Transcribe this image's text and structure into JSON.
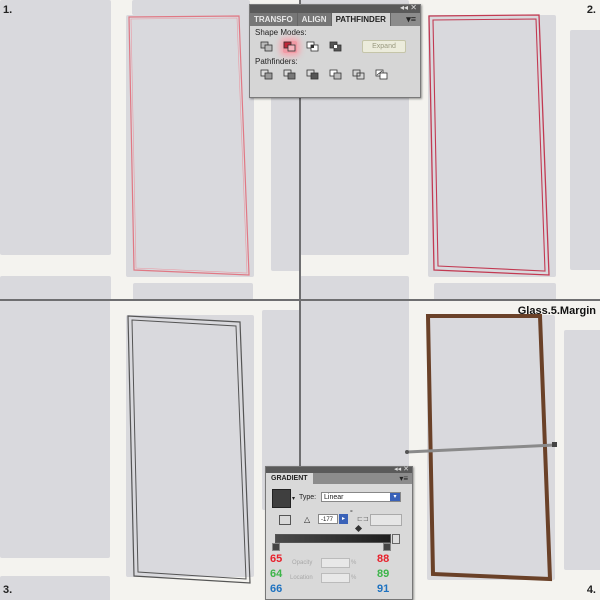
{
  "steps": [
    "1.",
    "2.",
    "3.",
    "4."
  ],
  "caption": "Glass.5.Margin",
  "pathfinder_panel": {
    "tabs": [
      "TRANSFO",
      "ALIGN",
      "PATHFINDER"
    ],
    "active_tab": "PATHFINDER",
    "controls_label": "◂◂ ✕",
    "menu_icon": "▾≡",
    "shape_modes_label": "Shape Modes:",
    "pathfinders_label": "Pathfinders:",
    "expand_label": "Expand",
    "highlighted_mode": "minus-front"
  },
  "gradient_panel": {
    "title": "GRADIENT",
    "menu_icon": "▾≡",
    "controls_label": "◂◂ ✕",
    "type_label": "Type:",
    "type_value": "Linear",
    "angle_value": "-177",
    "degree": "°",
    "opacity_label": "Opacity",
    "location_label": "Location",
    "percent": "%",
    "stop_left": {
      "r": "65",
      "g": "64",
      "b": "66"
    },
    "stop_right": {
      "r": "88",
      "g": "89",
      "b": "91"
    },
    "colors": {
      "r": "#e8202b",
      "g": "#3db54a",
      "b": "#1e72c0",
      "gradient_start": "#4a4a4a",
      "gradient_end": "#1e1e1e"
    }
  },
  "colors": {
    "wall": "#f4f3ef",
    "pane": "#d9d9dd",
    "step1_outline": "#e07884",
    "step2_outline": "#c23a52",
    "step3_outline": "#555555",
    "step4_frame": "#6a4128"
  }
}
